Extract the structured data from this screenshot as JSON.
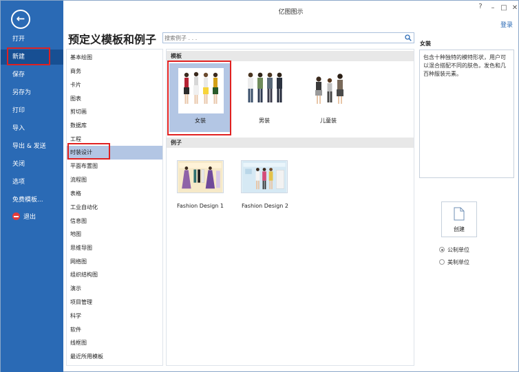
{
  "window": {
    "title": "亿图图示",
    "login_label": "登录"
  },
  "sidebar": {
    "back_icon": "back-arrow-icon",
    "items": [
      {
        "label": "打开"
      },
      {
        "label": "新建"
      },
      {
        "label": "保存"
      },
      {
        "label": "另存为"
      },
      {
        "label": "打印"
      },
      {
        "label": "导入"
      },
      {
        "label": "导出 & 发送"
      },
      {
        "label": "关闭"
      },
      {
        "label": "选项"
      },
      {
        "label": "免费模板..."
      },
      {
        "label": "退出"
      }
    ],
    "active_item": "新建"
  },
  "main": {
    "title": "预定义模板和例子",
    "search": {
      "value": "",
      "placeholder": "搜索例子 . . ."
    }
  },
  "categories": [
    "基本绘图",
    "商务",
    "卡片",
    "图表",
    "剪切画",
    "数据库",
    "工程",
    "时装设计",
    "平面布置图",
    "流程图",
    "表格",
    "工业自动化",
    "信息图",
    "地图",
    "思维导图",
    "网络图",
    "组织结构图",
    "演示",
    "项目管理",
    "科学",
    "软件",
    "线框图",
    "最近所用模板"
  ],
  "selected_category": "时装设计",
  "gallery": {
    "templates_heading": "模板",
    "templates": [
      {
        "label": "女装"
      },
      {
        "label": "男装"
      },
      {
        "label": "儿童装"
      }
    ],
    "examples_heading": "例子",
    "examples": [
      {
        "label": "Fashion Design 1"
      },
      {
        "label": "Fashion Design 2"
      }
    ]
  },
  "info": {
    "title": "女装",
    "description": "包含十种独特的模特形状，用户可以混合搭配不同的肤色，发色和几百种服装元素。"
  },
  "create": {
    "label": "创建"
  },
  "units": [
    {
      "label": "公制单位",
      "selected": true
    },
    {
      "label": "美制单位",
      "selected": false
    }
  ],
  "colors": {
    "sidebar_bg": "#2a6ab5",
    "sidebar_active": "#174f93",
    "selection": "#b3c6e4",
    "highlight_border": "#e02020"
  }
}
